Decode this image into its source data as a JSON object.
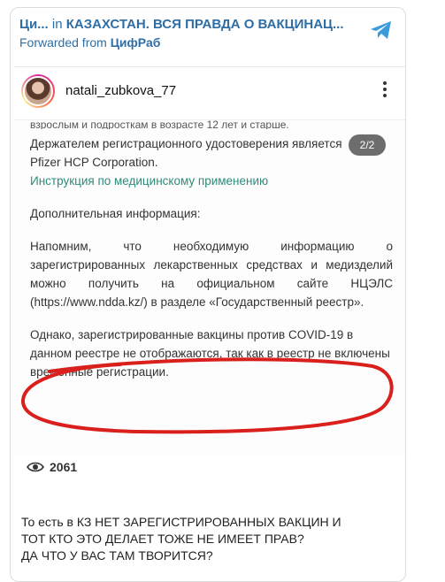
{
  "channel": {
    "name": "Ци...",
    "in_label": "in",
    "group": "КАЗАХСТАН. ВСЯ ПРАВДА О ВАКЦИНАЦ...",
    "forwarded_prefix": "Forwarded from",
    "forwarded_from": "ЦифРаб",
    "icon": "telegram-icon",
    "accent": "#2f6ea5"
  },
  "post": {
    "username": "natali_zubkova_77",
    "more_icon": "more-vertical-icon",
    "image_counter": "2/2",
    "views": "2061",
    "views_icon": "eye-icon",
    "document": {
      "cut_line": "взрослым и подросткам в возрасте 12 лет и старше.",
      "holder_line1": "Держателем регистрационного удостоверения является",
      "holder_line2": "Pfizer HCP Corporation.",
      "instruction_link": "Инструкция по медицинскому применению",
      "additional_info": "Дополнительная информация:",
      "reminder": "Напомним, что необходимую информацию о зарегистрированных лекарственных средствах и медизделий можно получить на официальном сайте НЦЭЛС (https://www.ndda.kz/) в разделе «Государственный реестр».",
      "highlight": "Однако, зарегистрированные вакцины против COVID-19 в данном реестре не отображаются, так как в реестр не включены временные регистрации.",
      "highlight_color": "#d9201c"
    }
  },
  "caption": {
    "line1": "То есть в КЗ НЕТ ЗАРЕГИСТРИРОВАННЫХ ВАКЦИН И",
    "line2": "ТОТ КТО ЭТО ДЕЛАЕТ ТОЖЕ НЕ ИМЕЕТ ПРАВ?",
    "line3": "ДА ЧТО У ВАС ТАМ ТВОРИТСЯ?"
  }
}
